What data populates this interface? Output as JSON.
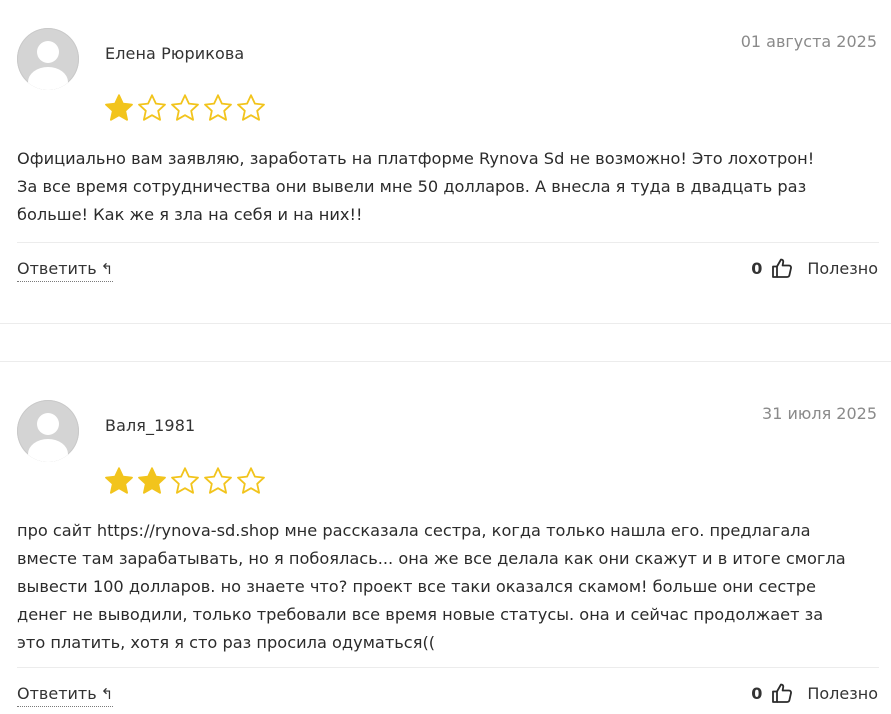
{
  "colors": {
    "star_fill": "#F2C41C",
    "star_outline": "#F2C41C",
    "avatar_bg": "#D4D4D4",
    "date_text": "#8A8A8A"
  },
  "reviews": [
    {
      "author": "Елена Рюрикова",
      "date": "01 августа 2025",
      "rating": 1,
      "max_rating": 5,
      "text_lines": [
        "Официально вам заявляю, заработать на платформе Rynova Sd не возможно! Это лохотрон!",
        "За все время сотрудничества они вывели мне 50 долларов. А внесла я туда в двадцать раз",
        "больше! Как же я зла на себя и на них!!"
      ],
      "reply_label": "Ответить",
      "reply_icon": "↰",
      "useful_count": "0",
      "useful_label": "Полезно",
      "thumb_icon": "thumbs-up-icon"
    },
    {
      "author": "Валя_1981",
      "date": "31 июля 2025",
      "rating": 2,
      "max_rating": 5,
      "text_lines": [
        "про сайт https://rynova-sd.shop мне рассказала сестра, когда только нашла его. предлагала",
        "вместе там зарабатывать, но я побоялась... она же все делала как они скажут и в итоге смогла",
        "вывести 100 долларов. но знаете что? проект все таки оказался скамом! больше они сестре",
        "денег не выводили, только требовали все время новые статусы. она и сейчас продолжает за",
        "это платить, хотя я сто раз просила одуматься(("
      ],
      "reply_label": "Ответить",
      "reply_icon": "↰",
      "useful_count": "0",
      "useful_label": "Полезно",
      "thumb_icon": "thumbs-up-icon"
    }
  ]
}
